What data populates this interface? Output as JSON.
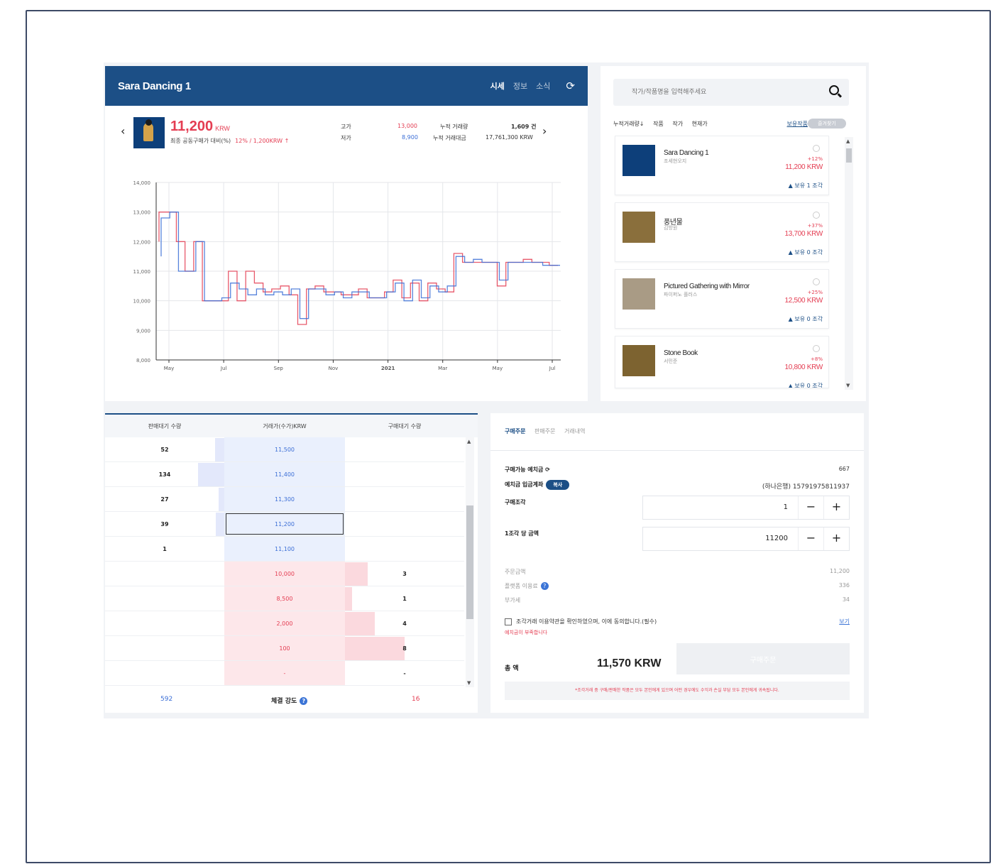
{
  "header": {
    "title": "Sara Dancing 1",
    "tabs": [
      "시세",
      "정보",
      "소식"
    ],
    "active_tab": "시세"
  },
  "summary": {
    "price": "11,200",
    "currency": "KRW",
    "subtitle": "최종 공동구매가 대비(%)",
    "change": "12% / 1,200KRW ↑",
    "high_label": "고가",
    "high_value": "13,000",
    "low_label": "저가",
    "low_value": "8,900",
    "volume_label": "누적 거래량",
    "volume_value": "1,609 건",
    "amount_label": "누적 거래대금",
    "amount_value": "17,761,300 KRW"
  },
  "chart_data": {
    "type": "line",
    "title": "",
    "ylim": [
      8000,
      14000
    ],
    "y_ticks": [
      "14,000",
      "13,000",
      "12,000",
      "11,000",
      "10,000",
      "9,000",
      "8,000"
    ],
    "x_ticks": [
      "May",
      "Jul",
      "Sep",
      "Nov",
      "2021",
      "Mar",
      "May",
      "Jul"
    ],
    "series": [
      {
        "color": "#e43d52",
        "values": [
          12000,
          13000,
          13000,
          12000,
          11000,
          12000,
          10000,
          10000,
          10000,
          11000,
          10000,
          11000,
          10600,
          10300,
          10400,
          10500,
          10200,
          9200,
          10400,
          10500,
          10300,
          10300,
          10200,
          10200,
          10400,
          10100,
          10100,
          10300,
          10700,
          10100,
          10600,
          10000,
          10600,
          10400,
          10300,
          11600,
          11300,
          11300,
          11300,
          11300,
          10500,
          11300,
          11300,
          11400,
          11300,
          11300,
          11200
        ]
      },
      {
        "color": "#3b6ed6",
        "values": [
          11500,
          12800,
          13000,
          11000,
          11000,
          12000,
          10000,
          10000,
          10100,
          10600,
          10400,
          10200,
          10400,
          10200,
          10300,
          10200,
          10400,
          9400,
          10400,
          10400,
          10200,
          10300,
          10100,
          10300,
          10300,
          10100,
          10100,
          10300,
          10600,
          10000,
          10700,
          10100,
          10500,
          10300,
          10500,
          11500,
          11300,
          11400,
          11300,
          11300,
          10700,
          11300,
          11300,
          11300,
          11300,
          11200,
          11200
        ]
      }
    ]
  },
  "search": {
    "placeholder": "작가/작품명을 입력해주세요"
  },
  "list_sort": [
    "누적거래량↓",
    "작품",
    "작가",
    "현재가"
  ],
  "list_favorites": "보유작품",
  "list_toggle": "즐겨찾기",
  "artworks": [
    {
      "name": "Sara Dancing 1",
      "artist": "조세현오지",
      "pct": "+12%",
      "price": "11,200 KRW",
      "hold": "보유 1 조각"
    },
    {
      "name": "풍년물",
      "artist": "김방원",
      "pct": "+37%",
      "price": "13,700 KRW",
      "hold": "보유 0 조각"
    },
    {
      "name": "Pictured Gathering with Mirror",
      "artist": "파이퍼노 플러스",
      "pct": "+25%",
      "price": "12,500 KRW",
      "hold": "보유 0 조각"
    },
    {
      "name": "Stone Book",
      "artist": "서민준",
      "pct": "+8%",
      "price": "10,800 KRW",
      "hold": "보유 0 조각"
    }
  ],
  "orderbook": {
    "headers": [
      "판매대기 수량",
      "거래가(수가)KRW",
      "구매대기 수량"
    ],
    "sell_rows": [
      {
        "qty": "52",
        "price": "11,500",
        "bar": 0.08
      },
      {
        "qty": "134",
        "price": "11,400",
        "bar": 0.22
      },
      {
        "qty": "27",
        "price": "11,300",
        "bar": 0.05
      },
      {
        "qty": "39",
        "price": "11,200",
        "bar": 0.07
      },
      {
        "qty": "1",
        "price": "11,100",
        "bar": 0.0
      }
    ],
    "buy_rows": [
      {
        "qty": "3",
        "price": "10,000",
        "bar": 0.19
      },
      {
        "qty": "1",
        "price": "8,500",
        "bar": 0.06
      },
      {
        "qty": "4",
        "price": "2,000",
        "bar": 0.25
      },
      {
        "qty": "8",
        "price": "100",
        "bar": 0.5
      },
      {
        "qty": "-",
        "price": "-",
        "bar": 0.0
      }
    ],
    "footer_sell": "592",
    "footer_label": "체결 강도",
    "footer_buy": "16"
  },
  "order": {
    "tabs": [
      "구매주문",
      "판매주문",
      "거래내역"
    ],
    "active_tab": "구매주문",
    "deposit_label": "구매가능 예치금",
    "deposit_value": "667",
    "account_label": "예치금 입금계좌",
    "account_badge": "복사",
    "account_value": "(하나은행) 15791975811937",
    "qty_label": "구매조각",
    "qty_value": "1",
    "unit_label": "1조각 당 금액",
    "unit_value": "11200",
    "amount_label": "주문금액",
    "amount_value": "11,200",
    "fee_label": "플랫폼 이용료",
    "fee_value": "336",
    "vat_label": "부가세",
    "vat_value": "34",
    "agree_text": "조각거래 이용약관을 확인하였으며, 이에 동의합니다.(필수)",
    "view_label": "보기",
    "warn_text": "예치금이 부족합니다",
    "total_label": "총 액",
    "total_value": "11,570 KRW",
    "buy_label": "구매주문",
    "notice": "*조각거래 중 구매/판매한 작품은 모두 본인에게 있으며 어떤 경우에도 수익과 손실 부담 모두 본인에게 귀속됩니다."
  }
}
